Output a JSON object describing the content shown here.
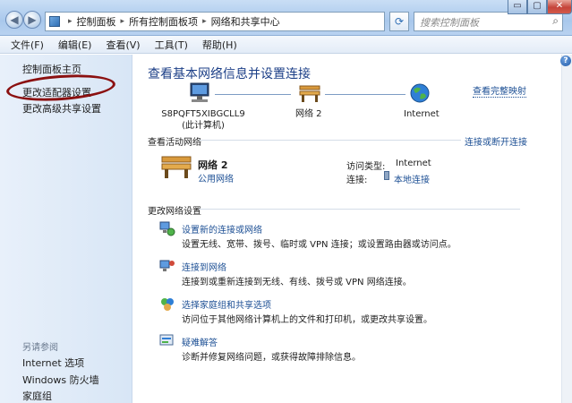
{
  "window": {
    "breadcrumbs": [
      "控制面板",
      "所有控制面板项",
      "网络和共享中心"
    ],
    "search_placeholder": "搜索控制面板",
    "controls": {
      "minimize": "▭",
      "maximize": "▢",
      "close": "✕"
    }
  },
  "menubar": [
    "文件(F)",
    "编辑(E)",
    "查看(V)",
    "工具(T)",
    "帮助(H)"
  ],
  "sidebar": {
    "links": [
      "控制面板主页",
      "更改适配器设置",
      "更改高级共享设置"
    ],
    "see_also_heading": "另请参阅",
    "see_also": [
      "Internet 选项",
      "Windows 防火墙",
      "家庭组"
    ],
    "annotation_color": "#8b1010"
  },
  "main": {
    "title": "查看基本网络信息并设置连接",
    "view_full_map": "查看完整映射",
    "network_map": {
      "computer_name": "S8PQFT5XIBGCLL9",
      "computer_note": "(此计算机)",
      "network_name": "网络  2",
      "internet": "Internet"
    },
    "active_networks": {
      "heading": "查看活动网络",
      "connect_disconnect": "连接或断开连接",
      "network_name": "网络  2",
      "network_type": "公用网络",
      "access_type_label": "访问类型:",
      "access_type_value": "Internet",
      "connection_label": "连接:",
      "connection_value": "本地连接"
    },
    "change_settings": {
      "heading": "更改网络设置",
      "tasks": [
        {
          "icon": "setup-connection-icon",
          "title": "设置新的连接或网络",
          "desc": "设置无线、宽带、拨号、临时或 VPN 连接；或设置路由器或访问点。"
        },
        {
          "icon": "connect-network-icon",
          "title": "连接到网络",
          "desc": "连接到或重新连接到无线、有线、拨号或 VPN 网络连接。"
        },
        {
          "icon": "homegroup-icon",
          "title": "选择家庭组和共享选项",
          "desc": "访问位于其他网络计算机上的文件和打印机，或更改共享设置。"
        },
        {
          "icon": "troubleshoot-icon",
          "title": "疑难解答",
          "desc": "诊断并修复网络问题，或获得故障排除信息。"
        }
      ]
    }
  }
}
